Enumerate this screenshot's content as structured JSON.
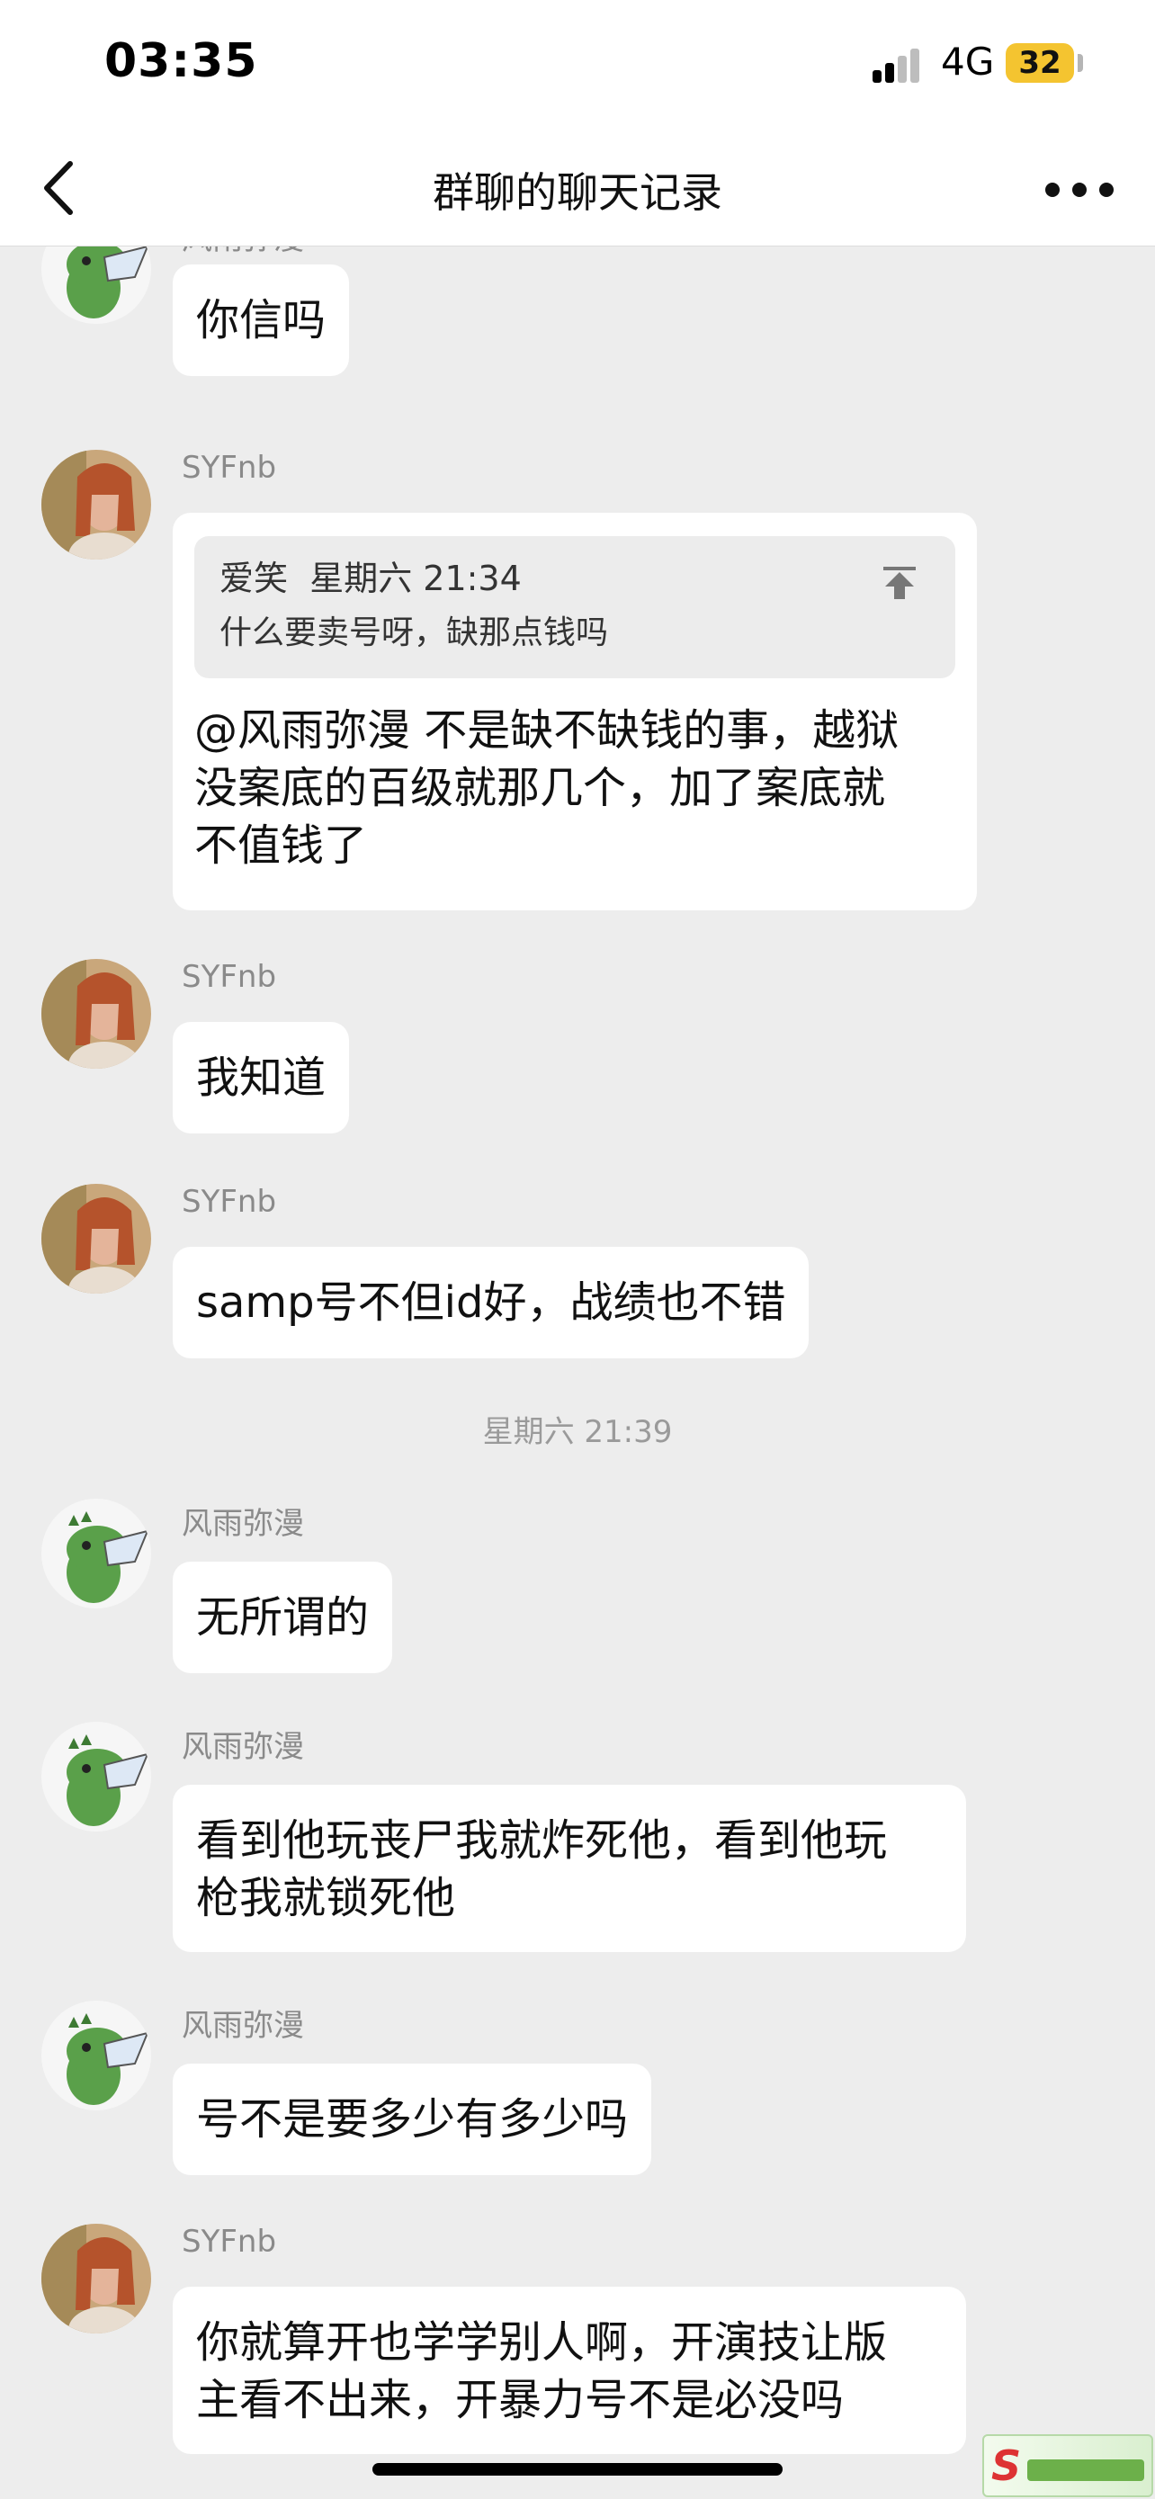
{
  "status_bar": {
    "time": "03:35",
    "network": "4G",
    "battery": "32",
    "battery_color": "#f4c430"
  },
  "nav": {
    "title": "群聊的聊天记录",
    "back_icon": "chevron-left-icon",
    "more_icon": "more-horizontal-icon"
  },
  "messages": [
    {
      "sender": "风雨弥漫",
      "text": "你信吗"
    },
    {
      "sender": "SYFnb",
      "quote": {
        "author": "爱笑",
        "time": "星期六 21:34",
        "text": "什么要卖号呀，缺那点钱吗"
      },
      "text_lines": [
        "@风雨弥漫 不是缺不缺钱的事，越狱",
        "没案底的百级就那几个，加了案底就",
        "不值钱了"
      ]
    },
    {
      "sender": "SYFnb",
      "text": "我知道"
    },
    {
      "sender": "SYFnb",
      "text": "samp号不但id好，战绩也不错"
    },
    {
      "sender": "风雨弥漫",
      "text": "无所谓的"
    },
    {
      "sender": "风雨弥漫",
      "text_lines": [
        "看到他玩丧尸我就炸死他，看到他玩",
        "枪我就锁死他"
      ]
    },
    {
      "sender": "风雨弥漫",
      "text": "号不是要多少有多少吗"
    },
    {
      "sender": "SYFnb",
      "text_lines": [
        "你就算开也学学别人啊，开演技让版",
        "主看不出来，开暴力号不是必没吗"
      ]
    }
  ],
  "time_separator": "星期六 21:39"
}
